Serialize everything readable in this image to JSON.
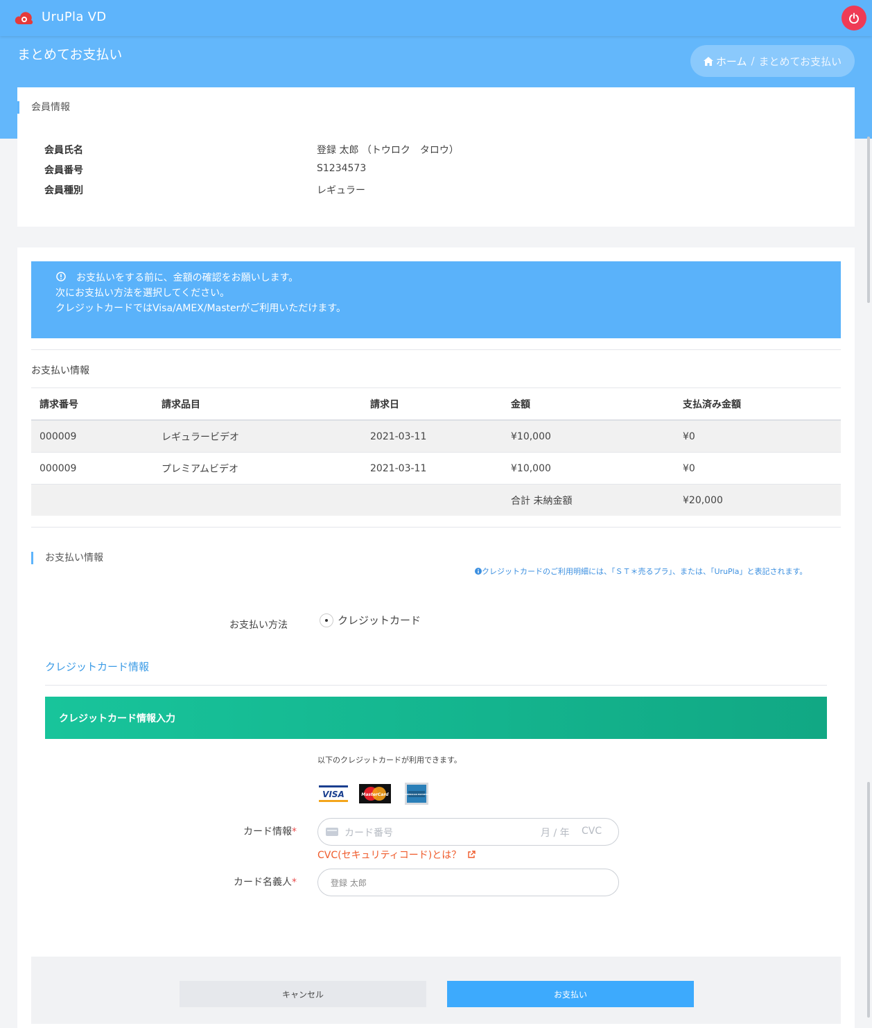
{
  "app": {
    "brand": "UruPla VD"
  },
  "page": {
    "title": "まとめてお支払い"
  },
  "breadcrumb": {
    "home": "ホーム",
    "separator": "/",
    "current": "まとめてお支払い"
  },
  "member": {
    "section_title": "会員情報",
    "rows": [
      {
        "label": "会員氏名",
        "value": "登録 太郎 （トウロク　タロウ）"
      },
      {
        "label": "会員番号",
        "value": "S1234573"
      },
      {
        "label": "会員種別",
        "value": "レギュラー"
      }
    ]
  },
  "alert": {
    "lines": [
      "お支払いをする前に、金額の確認をお願いします。",
      "次にお支払い方法を選択してください。",
      "クレジットカードではVisa/AMEX/Masterがご利用いただけます。"
    ]
  },
  "payment_table": {
    "section_title": "お支払い情報",
    "headers": [
      "請求番号",
      "請求品目",
      "請求日",
      "金額",
      "支払済み金額"
    ],
    "rows": [
      [
        "000009",
        "レギュラービデオ",
        "2021-03-11",
        "¥10,000",
        "¥0"
      ],
      [
        "000009",
        "プレミアムビデオ",
        "2021-03-11",
        "¥10,000",
        "¥0"
      ]
    ],
    "total_label": "合計 未納金額",
    "total_value": "¥20,000"
  },
  "payment_method": {
    "section_title": "お支払い情報",
    "statement_note": "クレジットカードのご利用明細には、「ＳＴ＊売るプラ」、または、「UruPla」と表記されます。",
    "method_label": "お支払い方法",
    "option_label": "クレジットカード"
  },
  "credit_card": {
    "link_label": "クレジットカード情報",
    "banner_title": "クレジットカード情報入力",
    "available_note": "以下のクレジットカードが利用できます。",
    "brands": [
      "VISA",
      "MasterCard",
      "AMERICAN EXPRESS"
    ],
    "card_info_label": "カード情報",
    "card_number_placeholder": "カード番号",
    "expiry_placeholder": "月 / 年",
    "cvc_placeholder": "CVC",
    "cvc_help": "CVC(セキュリティコード)とは？",
    "holder_label": "カード名義人",
    "holder_placeholder": "登録 太郎",
    "required_mark": "*"
  },
  "actions": {
    "cancel_label": "キャンセル",
    "pay_label": "お支払い"
  },
  "colors": {
    "primary": "#5eb4fb",
    "danger": "#ef3b55",
    "success": "#18c49b",
    "link": "#3b9be6",
    "warning_text": "#ef5a2a"
  }
}
